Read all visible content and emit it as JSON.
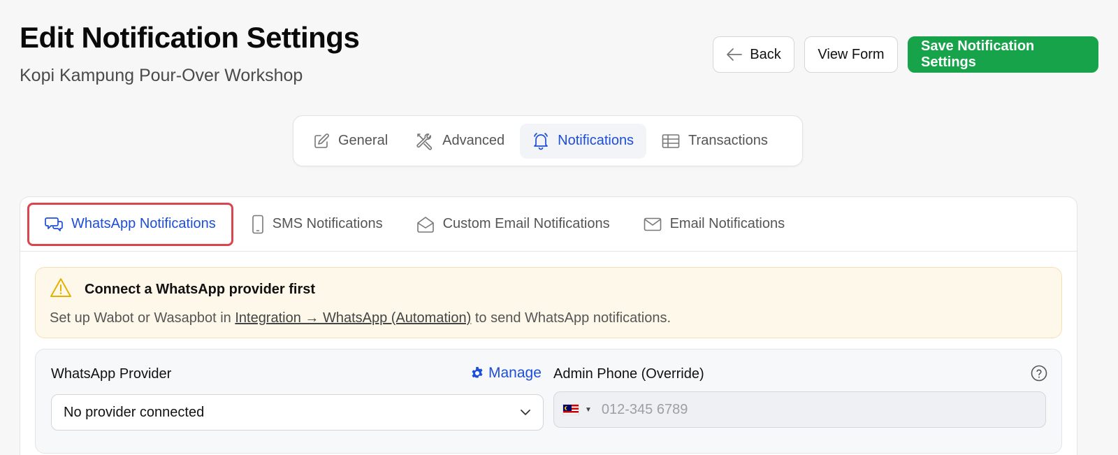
{
  "header": {
    "title": "Edit Notification Settings",
    "subtitle": "Kopi Kampung Pour-Over Workshop",
    "back_label": "Back",
    "view_form_label": "View Form",
    "save_label": "Save Notification Settings"
  },
  "main_tabs": [
    {
      "label": "General",
      "icon": "pencil-square-icon"
    },
    {
      "label": "Advanced",
      "icon": "tools-icon"
    },
    {
      "label": "Notifications",
      "icon": "bell-icon",
      "active": true
    },
    {
      "label": "Transactions",
      "icon": "table-icon"
    }
  ],
  "sub_tabs": [
    {
      "label": "WhatsApp Notifications",
      "icon": "chat-bubbles-icon",
      "active": true
    },
    {
      "label": "SMS Notifications",
      "icon": "phone-icon"
    },
    {
      "label": "Custom Email Notifications",
      "icon": "open-envelope-icon"
    },
    {
      "label": "Email Notifications",
      "icon": "envelope-icon"
    }
  ],
  "alert": {
    "title": "Connect a WhatsApp provider first",
    "text_before": "Set up Wabot or Wasapbot in ",
    "link": "Integration → WhatsApp (Automation)",
    "text_after": " to send WhatsApp notifications."
  },
  "settings": {
    "provider_label": "WhatsApp Provider",
    "manage_label": "Manage",
    "provider_value": "No provider connected",
    "admin_phone_label": "Admin Phone (Override)",
    "phone_placeholder": "012-345 6789"
  },
  "colors": {
    "primary": "#16a34a",
    "accent": "#1d4ed8",
    "highlight_border": "#d9464d",
    "alert_bg": "#fef8ea"
  }
}
